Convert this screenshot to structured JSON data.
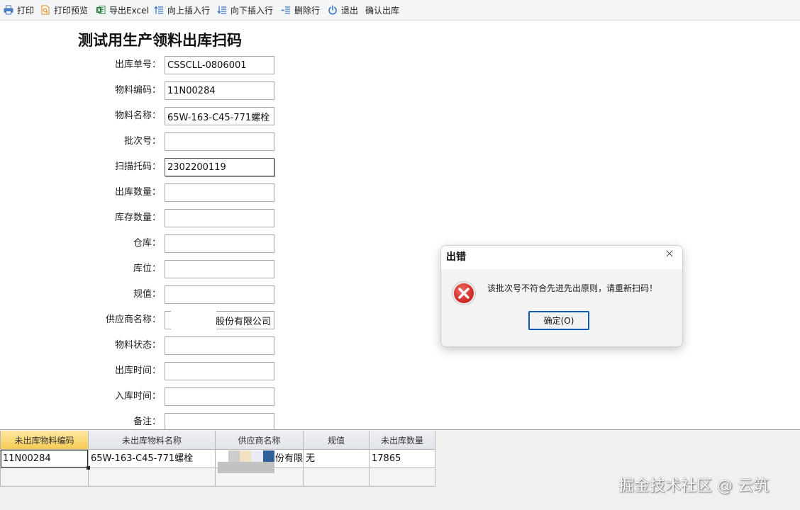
{
  "toolbar": {
    "items": [
      {
        "label": "打印",
        "icon": "printer-icon"
      },
      {
        "label": "打印预览",
        "icon": "print-preview-icon"
      },
      {
        "label": "导出Excel",
        "icon": "excel-icon"
      },
      {
        "label": "向上插入行",
        "icon": "insert-row-above-icon"
      },
      {
        "label": "向下插入行",
        "icon": "insert-row-below-icon"
      },
      {
        "label": "删除行",
        "icon": "delete-row-icon"
      },
      {
        "label": "退出",
        "icon": "power-icon"
      },
      {
        "label": "确认出库"
      }
    ]
  },
  "form": {
    "title": "测试用生产领料出库扫码",
    "fields": [
      {
        "label": "出库单号：",
        "value": "CSSCLL-0806001"
      },
      {
        "label": "物料编码：",
        "value": "11N00284"
      },
      {
        "label": "物料名称：",
        "value": "65W-163-C45-771螺栓"
      },
      {
        "label": "批次号：",
        "value": ""
      },
      {
        "label": "扫描托码：",
        "value": "2302200119"
      },
      {
        "label": "出库数量：",
        "value": ""
      },
      {
        "label": "库存数量：",
        "value": ""
      },
      {
        "label": "仓库：",
        "value": ""
      },
      {
        "label": "库位：",
        "value": ""
      },
      {
        "label": "规值：",
        "value": ""
      },
      {
        "label": "供应商名称：",
        "value": "股份有限公司"
      },
      {
        "label": "物料状态：",
        "value": ""
      },
      {
        "label": "出库时间：",
        "value": ""
      },
      {
        "label": "入库时间：",
        "value": ""
      },
      {
        "label": "备注：",
        "value": ""
      }
    ]
  },
  "dialog": {
    "title": "出错",
    "message": "该批次号不符合先进先出原则，请重新扫码！",
    "ok_label": "确定(O)",
    "icon": "error-icon",
    "close_icon": "close-icon"
  },
  "grid": {
    "columns": [
      "未出库物料编码",
      "未出库物料名称",
      "供应商名称",
      "规值",
      "未出库数量"
    ],
    "rows": [
      [
        "11N00284",
        "65W-163-C45-771螺栓",
        "份有限",
        "无",
        "17865"
      ],
      [
        "",
        "",
        "",
        "",
        ""
      ]
    ]
  },
  "watermark": "掘金技术社区 @ 云筑",
  "colors": {
    "selected_header": "#f6cb52",
    "error_red": "#d4302b",
    "default_button_border": "#0a5ab6",
    "toolbar_icon_blue": "#3c78c8"
  }
}
